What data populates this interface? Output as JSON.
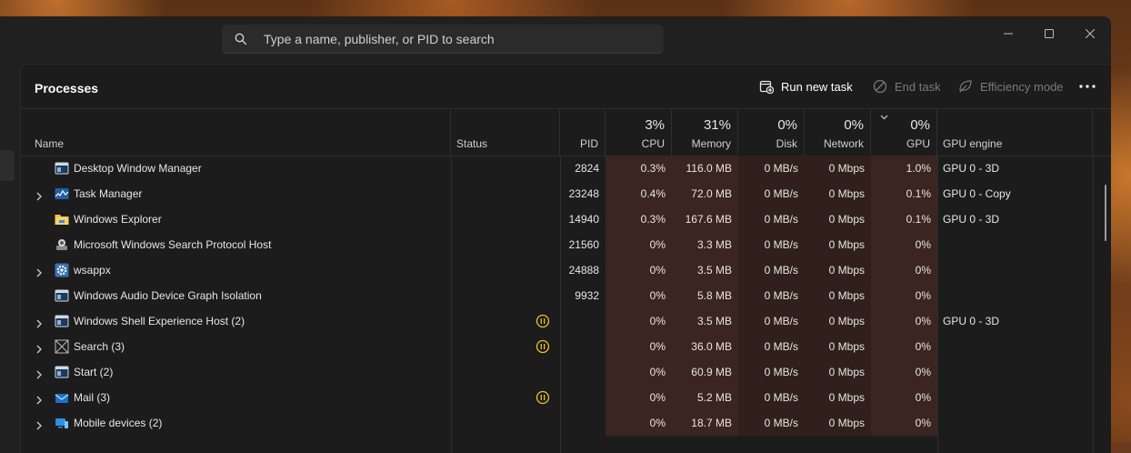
{
  "search": {
    "placeholder": "Type a name, publisher, or PID to search"
  },
  "header": {
    "title": "Processes",
    "run_new_task": "Run new task",
    "end_task": "End task",
    "efficiency_mode": "Efficiency mode"
  },
  "columns": {
    "name": "Name",
    "status": "Status",
    "pid": "PID",
    "cpu": {
      "pct": "3%",
      "label": "CPU"
    },
    "memory": {
      "pct": "31%",
      "label": "Memory"
    },
    "disk": {
      "pct": "0%",
      "label": "Disk"
    },
    "network": {
      "pct": "0%",
      "label": "Network"
    },
    "gpu": {
      "pct": "0%",
      "label": "GPU"
    },
    "gpu_engine": "GPU engine"
  },
  "processes": [
    {
      "name": "Desktop Window Manager",
      "expandable": false,
      "icon": "window-icon",
      "paused": false,
      "pid": "2824",
      "cpu": "0.3%",
      "memory": "116.0 MB",
      "disk": "0 MB/s",
      "network": "0 Mbps",
      "gpu": "1.0%",
      "gpu_engine": "GPU 0 - 3D"
    },
    {
      "name": "Task Manager",
      "expandable": true,
      "icon": "task-manager-icon",
      "paused": false,
      "pid": "23248",
      "cpu": "0.4%",
      "memory": "72.0 MB",
      "disk": "0 MB/s",
      "network": "0 Mbps",
      "gpu": "0.1%",
      "gpu_engine": "GPU 0 - Copy"
    },
    {
      "name": "Windows Explorer",
      "expandable": false,
      "icon": "folder-icon",
      "paused": false,
      "pid": "14940",
      "cpu": "0.3%",
      "memory": "167.6 MB",
      "disk": "0 MB/s",
      "network": "0 Mbps",
      "gpu": "0.1%",
      "gpu_engine": "GPU 0 - 3D"
    },
    {
      "name": "Microsoft Windows Search Protocol Host",
      "expandable": false,
      "icon": "search-host-icon",
      "paused": false,
      "pid": "21560",
      "cpu": "0%",
      "memory": "3.3 MB",
      "disk": "0 MB/s",
      "network": "0 Mbps",
      "gpu": "0%",
      "gpu_engine": ""
    },
    {
      "name": "wsappx",
      "expandable": true,
      "icon": "gear-icon",
      "paused": false,
      "pid": "24888",
      "cpu": "0%",
      "memory": "3.5 MB",
      "disk": "0 MB/s",
      "network": "0 Mbps",
      "gpu": "0%",
      "gpu_engine": ""
    },
    {
      "name": "Windows Audio Device Graph Isolation",
      "expandable": false,
      "icon": "window-icon",
      "paused": false,
      "pid": "9932",
      "cpu": "0%",
      "memory": "5.8 MB",
      "disk": "0 MB/s",
      "network": "0 Mbps",
      "gpu": "0%",
      "gpu_engine": ""
    },
    {
      "name": "Windows Shell Experience Host (2)",
      "expandable": true,
      "icon": "window-icon",
      "paused": true,
      "pid": "",
      "cpu": "0%",
      "memory": "3.5 MB",
      "disk": "0 MB/s",
      "network": "0 Mbps",
      "gpu": "0%",
      "gpu_engine": "GPU 0 - 3D"
    },
    {
      "name": "Search (3)",
      "expandable": true,
      "icon": "search-app-icon",
      "paused": true,
      "pid": "",
      "cpu": "0%",
      "memory": "36.0 MB",
      "disk": "0 MB/s",
      "network": "0 Mbps",
      "gpu": "0%",
      "gpu_engine": ""
    },
    {
      "name": "Start (2)",
      "expandable": true,
      "icon": "window-icon",
      "paused": false,
      "pid": "",
      "cpu": "0%",
      "memory": "60.9 MB",
      "disk": "0 MB/s",
      "network": "0 Mbps",
      "gpu": "0%",
      "gpu_engine": ""
    },
    {
      "name": "Mail (3)",
      "expandable": true,
      "icon": "mail-icon",
      "paused": true,
      "pid": "",
      "cpu": "0%",
      "memory": "5.2 MB",
      "disk": "0 MB/s",
      "network": "0 Mbps",
      "gpu": "0%",
      "gpu_engine": ""
    },
    {
      "name": "Mobile devices (2)",
      "expandable": true,
      "icon": "mobile-devices-icon",
      "paused": false,
      "pid": "",
      "cpu": "0%",
      "memory": "18.7 MB",
      "disk": "0 MB/s",
      "network": "0 Mbps",
      "gpu": "0%",
      "gpu_engine": ""
    }
  ],
  "colors": {
    "window_bg": "#202020",
    "panel_bg": "#1c1c1c",
    "heat_cell": "#3b2520",
    "status_paused": "#e8c22a"
  }
}
